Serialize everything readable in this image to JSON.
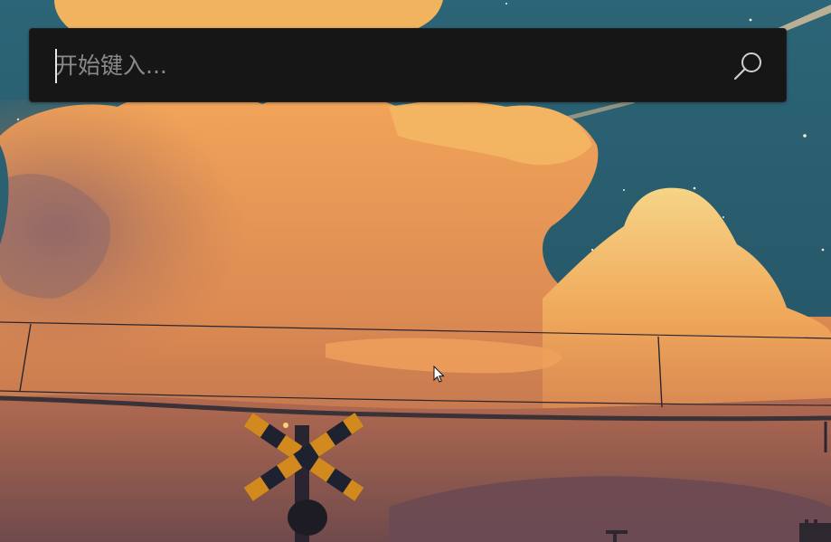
{
  "search": {
    "placeholder": "开始键入..."
  },
  "icons": {
    "search": "search-icon",
    "cursor": "mouse-pointer-icon"
  },
  "colors": {
    "search_bar_bg": "#161616",
    "placeholder_text": "#8a8a8a",
    "sky": "#2d6174",
    "cloud_orange": "#e9954a"
  }
}
